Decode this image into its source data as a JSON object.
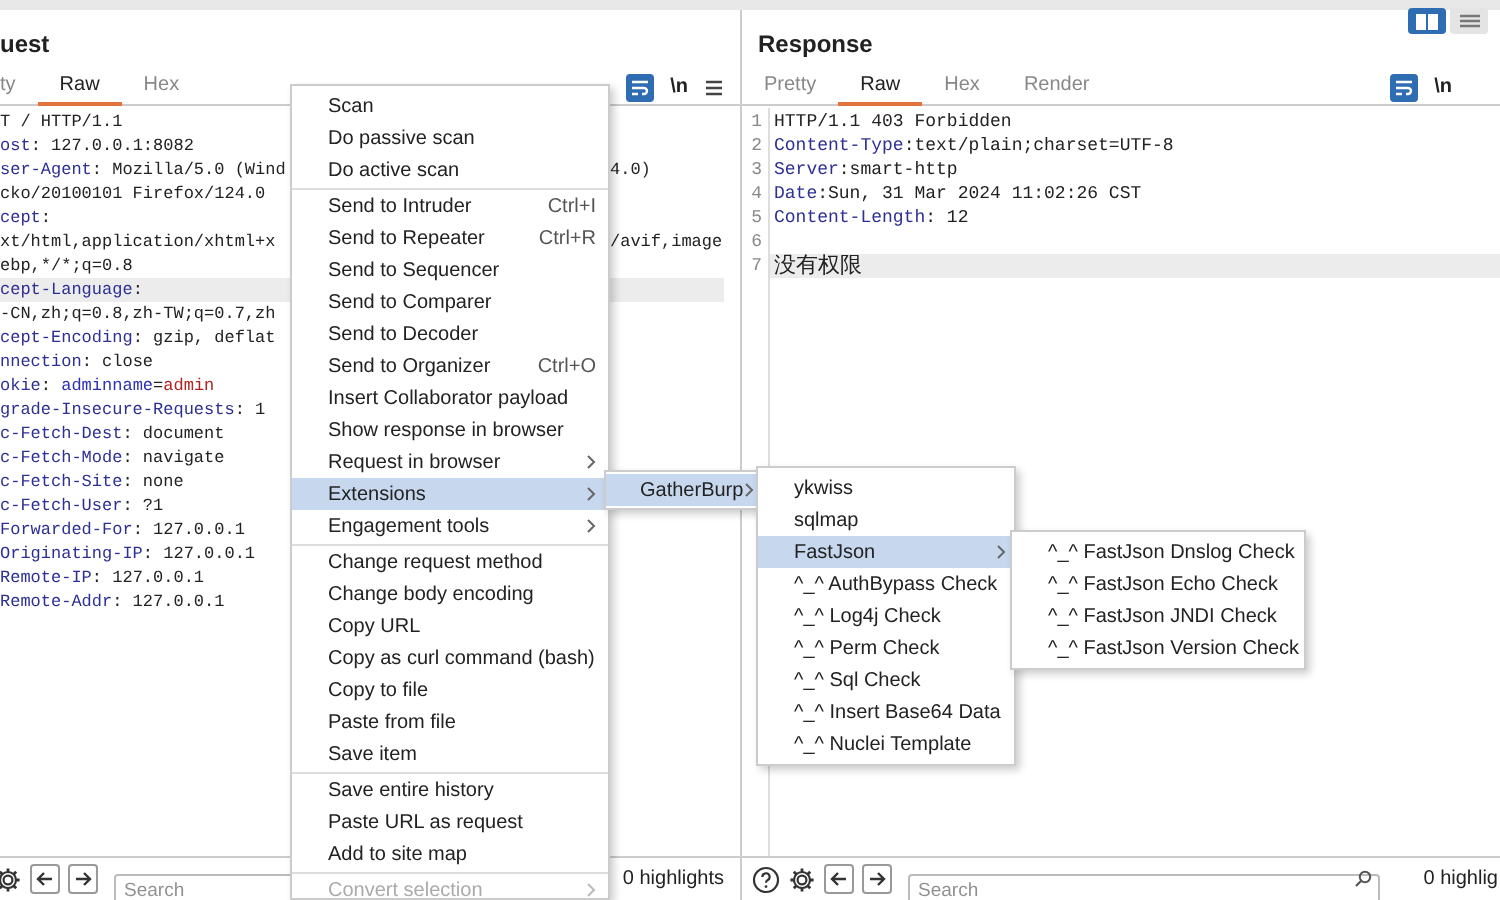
{
  "request": {
    "title": "uest",
    "tabs": [
      {
        "label": "ty",
        "selected": false
      },
      {
        "label": "Raw",
        "selected": true
      },
      {
        "label": "Hex",
        "selected": false
      }
    ],
    "toolbar": {
      "newline_label": "\\n"
    },
    "lines": [
      {
        "parts": [
          {
            "kind": "plain",
            "text": "T / HTTP/1.1"
          }
        ],
        "highlighted": false
      },
      {
        "parts": [
          {
            "kind": "key",
            "text": "ost"
          },
          {
            "kind": "plain",
            "text": ": 127.0.0.1:8082"
          }
        ],
        "highlighted": false
      },
      {
        "parts": [
          {
            "kind": "key",
            "text": "ser-Agent"
          },
          {
            "kind": "plain",
            "text": ": Mozilla/5.0 (Wind"
          }
        ],
        "right": "4.0)",
        "highlighted": false
      },
      {
        "parts": [
          {
            "kind": "plain",
            "text": "cko/20100101 Firefox/124.0"
          }
        ],
        "highlighted": false
      },
      {
        "parts": [
          {
            "kind": "key",
            "text": "cept"
          },
          {
            "kind": "plain",
            "text": ":"
          }
        ],
        "highlighted": false
      },
      {
        "parts": [
          {
            "kind": "plain",
            "text": "xt/html,application/xhtml+x"
          }
        ],
        "right": "/avif,image",
        "highlighted": false
      },
      {
        "parts": [
          {
            "kind": "plain",
            "text": "ebp,*/*;q=0.8"
          }
        ],
        "highlighted": false
      },
      {
        "parts": [
          {
            "kind": "key",
            "text": "cept-Language"
          },
          {
            "kind": "plain",
            "text": ":"
          }
        ],
        "highlighted": true
      },
      {
        "parts": [
          {
            "kind": "plain",
            "text": "-CN,zh;q=0.8,zh-TW;q=0.7,zh"
          }
        ],
        "highlighted": false
      },
      {
        "parts": [
          {
            "kind": "key",
            "text": "cept-Encoding"
          },
          {
            "kind": "plain",
            "text": ": gzip, deflat"
          }
        ],
        "highlighted": false
      },
      {
        "parts": [
          {
            "kind": "key",
            "text": "nnection"
          },
          {
            "kind": "plain",
            "text": ": close"
          }
        ],
        "highlighted": false
      },
      {
        "parts": [
          {
            "kind": "key",
            "text": "okie"
          },
          {
            "kind": "plain",
            "text": ": "
          },
          {
            "kind": "param",
            "text": "adminname"
          },
          {
            "kind": "plain",
            "text": "="
          },
          {
            "kind": "paramvalue",
            "text": "admin"
          }
        ],
        "highlighted": false
      },
      {
        "parts": [
          {
            "kind": "key",
            "text": "grade-Insecure-Requests"
          },
          {
            "kind": "plain",
            "text": ": 1"
          }
        ],
        "highlighted": false
      },
      {
        "parts": [
          {
            "kind": "key",
            "text": "c-Fetch-Dest"
          },
          {
            "kind": "plain",
            "text": ": document"
          }
        ],
        "highlighted": false
      },
      {
        "parts": [
          {
            "kind": "key",
            "text": "c-Fetch-Mode"
          },
          {
            "kind": "plain",
            "text": ": navigate"
          }
        ],
        "highlighted": false
      },
      {
        "parts": [
          {
            "kind": "key",
            "text": "c-Fetch-Site"
          },
          {
            "kind": "plain",
            "text": ": none"
          }
        ],
        "highlighted": false
      },
      {
        "parts": [
          {
            "kind": "key",
            "text": "c-Fetch-User"
          },
          {
            "kind": "plain",
            "text": ": ?1"
          }
        ],
        "highlighted": false
      },
      {
        "parts": [
          {
            "kind": "key",
            "text": "Forwarded-For"
          },
          {
            "kind": "plain",
            "text": ": 127.0.0.1"
          }
        ],
        "highlighted": false
      },
      {
        "parts": [
          {
            "kind": "key",
            "text": "Originating-IP"
          },
          {
            "kind": "plain",
            "text": ": 127.0.0.1"
          }
        ],
        "highlighted": false
      },
      {
        "parts": [
          {
            "kind": "key",
            "text": "Remote-IP"
          },
          {
            "kind": "plain",
            "text": ": 127.0.0.1"
          }
        ],
        "highlighted": false
      },
      {
        "parts": [
          {
            "kind": "key",
            "text": "Remote-Addr"
          },
          {
            "kind": "plain",
            "text": ": 127.0.0.1"
          }
        ],
        "highlighted": false
      }
    ],
    "search": {
      "placeholder": "Search"
    },
    "highlights": "0 highlights"
  },
  "response": {
    "title": "Response",
    "tabs": [
      {
        "label": "Pretty",
        "selected": false
      },
      {
        "label": "Raw",
        "selected": true
      },
      {
        "label": "Hex",
        "selected": false
      },
      {
        "label": "Render",
        "selected": false
      }
    ],
    "toolbar": {
      "newline_label": "\\n"
    },
    "lines": [
      {
        "number": "1",
        "parts": [
          {
            "kind": "plain",
            "text": "HTTP/1.1 403 Forbidden"
          }
        ],
        "highlighted": false
      },
      {
        "number": "2",
        "parts": [
          {
            "kind": "key",
            "text": "Content-Type"
          },
          {
            "kind": "plain",
            "text": ":text/plain;charset=UTF-8"
          }
        ],
        "highlighted": false
      },
      {
        "number": "3",
        "parts": [
          {
            "kind": "key",
            "text": "Server"
          },
          {
            "kind": "plain",
            "text": ":smart-http"
          }
        ],
        "highlighted": false
      },
      {
        "number": "4",
        "parts": [
          {
            "kind": "key",
            "text": "Date"
          },
          {
            "kind": "plain",
            "text": ":Sun, 31 Mar 2024 11:02:26 CST"
          }
        ],
        "highlighted": false
      },
      {
        "number": "5",
        "parts": [
          {
            "kind": "key",
            "text": "Content-Length"
          },
          {
            "kind": "plain",
            "text": ": 12"
          }
        ],
        "highlighted": false
      },
      {
        "number": "6",
        "highlighted": false
      },
      {
        "number": "7",
        "parts": [
          {
            "kind": "cjk",
            "text": "没有权限"
          }
        ],
        "highlighted": true
      }
    ],
    "search": {
      "placeholder": "Search"
    },
    "highlights": "0 highlig"
  },
  "layout_toggle": [
    {
      "selected": true
    },
    {
      "selected": false
    }
  ],
  "context_menu": {
    "groups": [
      [
        {
          "label": "Scan",
          "has_submenu": false,
          "selected": false,
          "disabled": false
        },
        {
          "label": "Do passive scan",
          "has_submenu": false,
          "selected": false,
          "disabled": false
        },
        {
          "label": "Do active scan",
          "has_submenu": false,
          "selected": false,
          "disabled": false
        }
      ],
      [
        {
          "label": "Send to Intruder",
          "shortcut": "Ctrl+I",
          "has_submenu": false,
          "selected": false,
          "disabled": false
        },
        {
          "label": "Send to Repeater",
          "shortcut": "Ctrl+R",
          "has_submenu": false,
          "selected": false,
          "disabled": false
        },
        {
          "label": "Send to Sequencer",
          "has_submenu": false,
          "selected": false,
          "disabled": false
        },
        {
          "label": "Send to Comparer",
          "has_submenu": false,
          "selected": false,
          "disabled": false
        },
        {
          "label": "Send to Decoder",
          "has_submenu": false,
          "selected": false,
          "disabled": false
        },
        {
          "label": "Send to Organizer",
          "shortcut": "Ctrl+O",
          "has_submenu": false,
          "selected": false,
          "disabled": false
        },
        {
          "label": "Insert Collaborator payload",
          "has_submenu": false,
          "selected": false,
          "disabled": false
        },
        {
          "label": "Show response in browser",
          "has_submenu": false,
          "selected": false,
          "disabled": false
        },
        {
          "label": "Request in browser",
          "has_submenu": true,
          "selected": false,
          "disabled": false
        },
        {
          "label": "Extensions",
          "has_submenu": true,
          "selected": true,
          "disabled": false
        },
        {
          "label": "Engagement tools",
          "has_submenu": true,
          "selected": false,
          "disabled": false
        }
      ],
      [
        {
          "label": "Change request method",
          "has_submenu": false,
          "selected": false,
          "disabled": false
        },
        {
          "label": "Change body encoding",
          "has_submenu": false,
          "selected": false,
          "disabled": false
        },
        {
          "label": "Copy URL",
          "has_submenu": false,
          "selected": false,
          "disabled": false
        },
        {
          "label": "Copy as curl command (bash)",
          "has_submenu": false,
          "selected": false,
          "disabled": false
        },
        {
          "label": "Copy to file",
          "has_submenu": false,
          "selected": false,
          "disabled": false
        },
        {
          "label": "Paste from file",
          "has_submenu": false,
          "selected": false,
          "disabled": false
        },
        {
          "label": "Save item",
          "has_submenu": false,
          "selected": false,
          "disabled": false
        }
      ],
      [
        {
          "label": "Save entire history",
          "has_submenu": false,
          "selected": false,
          "disabled": false
        },
        {
          "label": "Paste URL as request",
          "has_submenu": false,
          "selected": false,
          "disabled": false
        },
        {
          "label": "Add to site map",
          "has_submenu": false,
          "selected": false,
          "disabled": false
        }
      ],
      [
        {
          "label": "Convert selection",
          "has_submenu": true,
          "selected": false,
          "disabled": true
        }
      ]
    ]
  },
  "extensions_submenu": {
    "items": [
      {
        "label": "GatherBurp",
        "has_submenu": true,
        "selected": true,
        "disabled": false
      }
    ]
  },
  "gatherburp_submenu": {
    "items": [
      {
        "label": "ykwiss",
        "has_submenu": false,
        "selected": false,
        "disabled": false
      },
      {
        "label": "sqlmap",
        "has_submenu": false,
        "selected": false,
        "disabled": false
      },
      {
        "label": "FastJson",
        "has_submenu": true,
        "selected": true,
        "disabled": false
      },
      {
        "label": "^_^ AuthBypass Check",
        "has_submenu": false,
        "selected": false,
        "disabled": false
      },
      {
        "label": "^_^ Log4j Check",
        "has_submenu": false,
        "selected": false,
        "disabled": false
      },
      {
        "label": "^_^ Perm Check",
        "has_submenu": false,
        "selected": false,
        "disabled": false
      },
      {
        "label": "^_^ Sql Check",
        "has_submenu": false,
        "selected": false,
        "disabled": false
      },
      {
        "label": "^_^ Insert Base64 Data",
        "has_submenu": false,
        "selected": false,
        "disabled": false
      },
      {
        "label": "^_^ Nuclei Template",
        "has_submenu": false,
        "selected": false,
        "disabled": false
      }
    ]
  },
  "fastjson_submenu": {
    "items": [
      {
        "label": "^_^ FastJson Dnslog Check",
        "has_submenu": false,
        "selected": false,
        "disabled": false
      },
      {
        "label": "^_^ FastJson Echo Check",
        "has_submenu": false,
        "selected": false,
        "disabled": false
      },
      {
        "label": "^_^ FastJson JNDI Check",
        "has_submenu": false,
        "selected": false,
        "disabled": false
      },
      {
        "label": "^_^ FastJson Version Check",
        "has_submenu": false,
        "selected": false,
        "disabled": false
      }
    ]
  }
}
